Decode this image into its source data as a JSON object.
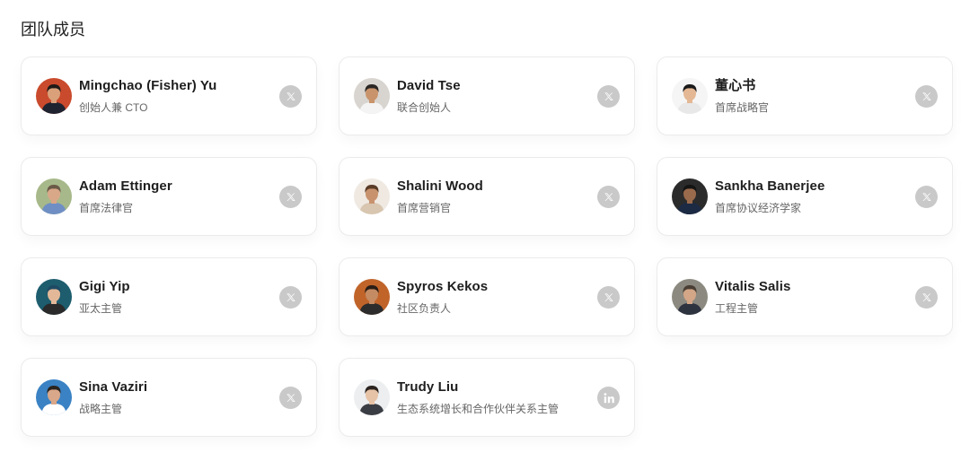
{
  "section": {
    "title": "团队成员"
  },
  "members": [
    {
      "name": "Mingchao (Fisher) Yu",
      "role": "创始人兼 CTO",
      "social": "x-icon",
      "avatar": {
        "bg": "#c94a2c",
        "skin": "#d9a07a",
        "hair": "#1e1a18",
        "shirt": "#1f2330"
      }
    },
    {
      "name": "David Tse",
      "role": "联合创始人",
      "social": "x-icon",
      "avatar": {
        "bg": "#d8d4cf",
        "skin": "#c9946c",
        "hair": "#2a2624",
        "shirt": "#f4f4f4"
      }
    },
    {
      "name": "董心书",
      "role": "首席战略官",
      "social": "x-icon",
      "avatar": {
        "bg": "#f5f5f5",
        "skin": "#e4b894",
        "hair": "#1a1a1a",
        "shirt": "#e8e8e8"
      }
    },
    {
      "name": "Adam Ettinger",
      "role": "首席法律官",
      "social": "x-icon",
      "avatar": {
        "bg": "#a7b98a",
        "skin": "#d9a889",
        "hair": "#6b5a48",
        "shirt": "#6f8fc4"
      }
    },
    {
      "name": "Shalini Wood",
      "role": "首席营销官",
      "social": "x-icon",
      "avatar": {
        "bg": "#efe9e2",
        "skin": "#c8926e",
        "hair": "#5a3b26",
        "shirt": "#d8c6b0"
      }
    },
    {
      "name": "Sankha Banerjee",
      "role": "首席协议经济学家",
      "social": "x-icon",
      "avatar": {
        "bg": "#2b2b2b",
        "skin": "#9a6a4c",
        "hair": "#141414",
        "shirt": "#1c2a44"
      }
    },
    {
      "name": "Gigi Yip",
      "role": "亚太主管",
      "social": "x-icon",
      "avatar": {
        "bg": "#1d5d6e",
        "skin": "#e2b898",
        "hair": "#1f4a64",
        "shirt": "#2a2a2a"
      }
    },
    {
      "name": "Spyros Kekos",
      "role": "社区负责人",
      "social": "x-icon",
      "avatar": {
        "bg": "#c0642a",
        "skin": "#c58b63",
        "hair": "#2a1d16",
        "shirt": "#2c2c2c"
      }
    },
    {
      "name": "Vitalis Salis",
      "role": "工程主管",
      "social": "x-icon",
      "avatar": {
        "bg": "#8c8a80",
        "skin": "#d2a687",
        "hair": "#4a3e34",
        "shirt": "#2e3340"
      }
    },
    {
      "name": "Sina Vaziri",
      "role": "战略主管",
      "social": "x-icon",
      "avatar": {
        "bg": "#3a82c4",
        "skin": "#d9a789",
        "hair": "#2a2420",
        "shirt": "#ffffff"
      }
    },
    {
      "name": "Trudy Liu",
      "role": "生态系统增长和合作伙伴关系主管",
      "social": "linkedin-icon",
      "avatar": {
        "bg": "#eceef0",
        "skin": "#e6c2a6",
        "hair": "#2c2420",
        "shirt": "#3b3d44"
      }
    }
  ]
}
